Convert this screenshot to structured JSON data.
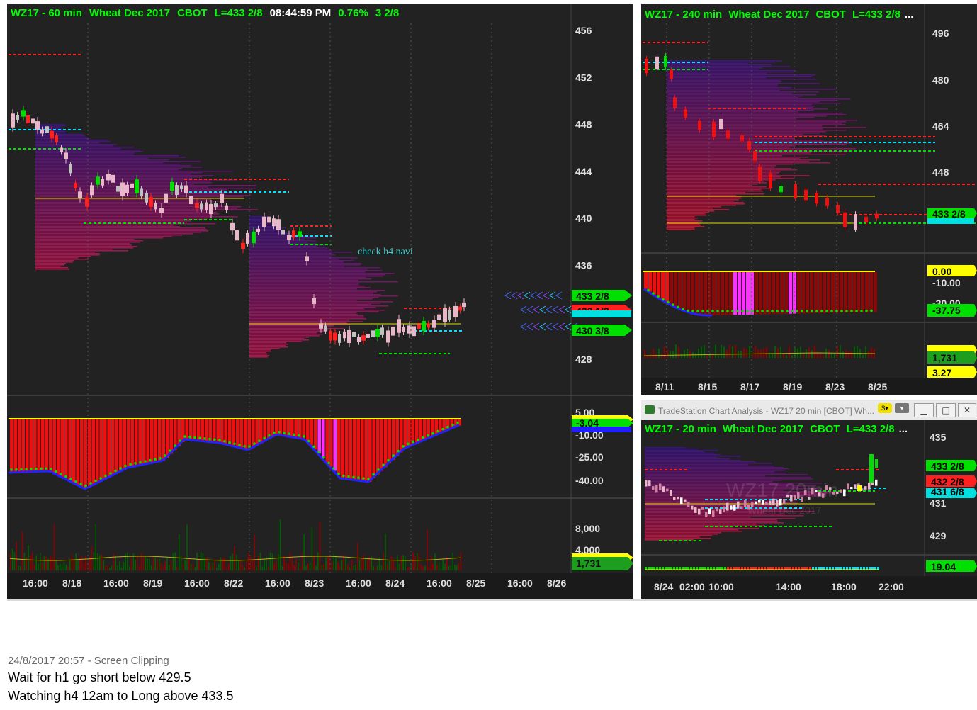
{
  "main_chart": {
    "title": "WZ17 - 60 min",
    "instrument": "Wheat Dec 2017",
    "exchange": "CBOT",
    "last": "L=433 2/8",
    "time": "08:44:59 PM",
    "pct": "0.76%",
    "change": "3 2/8",
    "annotation": "check h4 navi",
    "price_axis": [
      "456",
      "452",
      "448",
      "444",
      "440",
      "436",
      "432",
      "428"
    ],
    "price_tags": [
      {
        "text": "433 2/8",
        "color": "#00e000"
      },
      {
        "text": "432 1/8",
        "color": "#ff2020"
      },
      {
        "text": "430 3/8",
        "color": "#00e000"
      }
    ],
    "osc_axis": [
      "5.00",
      "-10.00",
      "-25.00",
      "-40.00"
    ],
    "osc_tag": "-3.04",
    "vol_axis": [
      "8,000",
      "4,000"
    ],
    "vol_tag": "1,731",
    "time_axis": [
      "16:00",
      "8/18",
      "16:00",
      "8/19",
      "16:00",
      "8/22",
      "16:00",
      "8/23",
      "16:00",
      "8/24",
      "16:00",
      "8/25",
      "16:00",
      "8/26"
    ]
  },
  "h4_chart": {
    "title": "WZ17 - 240 min",
    "instrument": "Wheat Dec 2017",
    "exchange": "CBOT",
    "last": "L=433 2/8",
    "ellipsis": "...",
    "price_axis": [
      "496",
      "480",
      "464",
      "448"
    ],
    "price_tag": "433 2/8",
    "osc_axis": [
      "0.00",
      "-10.00",
      "-30.00"
    ],
    "osc_tag": "-37.75",
    "vol_tags": [
      "1,731",
      "3.27"
    ],
    "time_axis": [
      "8/11",
      "8/15",
      "8/17",
      "8/19",
      "8/23",
      "8/25"
    ]
  },
  "m20_window": {
    "window_title": "TradeStation Chart Analysis - WZ17 20 min [CBOT] Wh...",
    "title": "WZ17 - 20 min",
    "instrument": "Wheat Dec 2017",
    "exchange": "CBOT",
    "last": "L=433 2/8",
    "ellipsis": "...",
    "watermark": "WZ17 20min",
    "watermark_sub": "Wheat Dec 2017",
    "price_axis": [
      "435",
      "431",
      "429"
    ],
    "price_tags": [
      {
        "text": "433 2/8",
        "color": "#00e000"
      },
      {
        "text": "432 2/8",
        "color": "#ff2020"
      },
      {
        "text": "431 6/8",
        "color": "#00e0e0"
      }
    ],
    "osc_tag": "19.04",
    "time_axis": [
      "8/24",
      "02:00",
      "10:00",
      "14:00",
      "18:00",
      "22:00"
    ]
  },
  "clipping": {
    "caption": "24/8/2017 20:57 - Screen Clipping",
    "line1": "Wait for h1 go short below 429.5",
    "line2": "Watching h4 12am to Long above 433.5"
  },
  "colors": {
    "up": "#00e000",
    "down": "#ff1a1a",
    "title_green": "#00ff00",
    "background": "#222222",
    "yellow": "#ffff00",
    "cyan": "#00e5ff"
  }
}
